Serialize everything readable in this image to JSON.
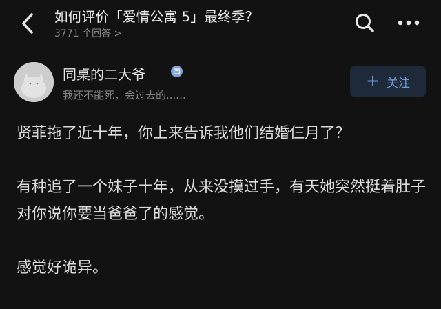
{
  "header": {
    "title": "如何评价「爱情公寓 5」最终季？",
    "answer_count": "3771 个回答 >"
  },
  "author": {
    "name": "同桌的二大爷",
    "bio": "我还不能死，会过去的......"
  },
  "follow_button": {
    "icon": "+",
    "label": "关注"
  },
  "answer": {
    "paragraphs": [
      "贤菲拖了近十年，你上来告诉我他们结婚仨月了？",
      "有种追了一个妹子十年，从来没摸过手，有天她突然挺着肚子对你说你要当爸爸了的感觉。",
      "感觉好诡异。"
    ]
  },
  "colors": {
    "background": "#121212",
    "accent": "#6f9ad6",
    "follow_bg": "#1e2a3a",
    "muted_text": "#858585"
  },
  "icons": [
    "back-arrow-icon",
    "search-icon",
    "more-dots-icon",
    "verified-badge-icon",
    "plus-icon"
  ]
}
